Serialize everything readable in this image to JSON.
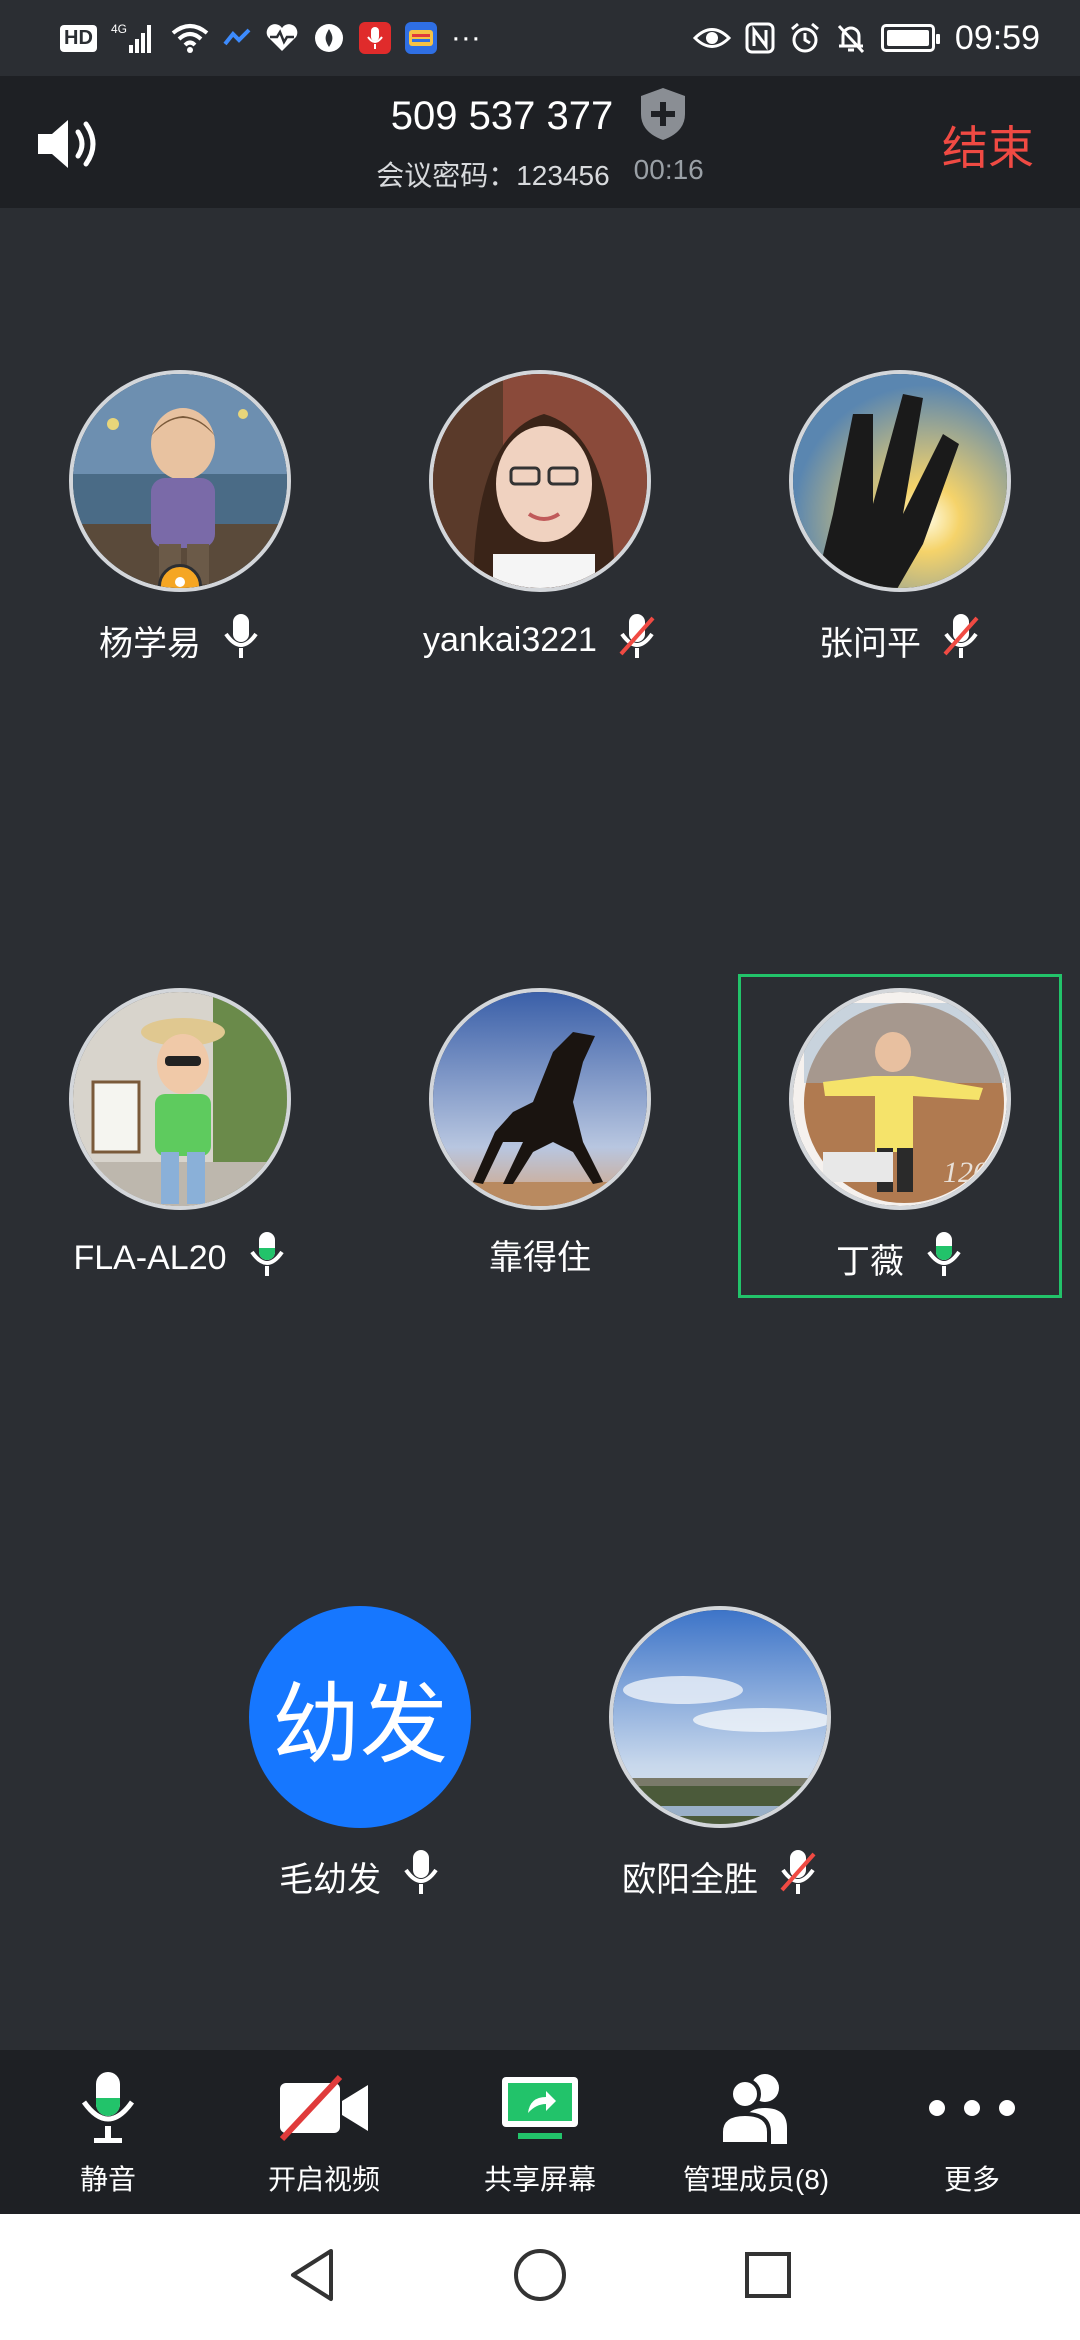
{
  "status_bar": {
    "left_icons": [
      "hd-icon",
      "signal-4g-icon",
      "wifi-icon",
      "app-icon",
      "health-icon",
      "app-icon",
      "mic-app-icon",
      "app-icon",
      "more-dots"
    ],
    "network": "4G",
    "hd": "HD",
    "more": "···",
    "time": "09:59"
  },
  "header": {
    "meeting_id": "509 537 377",
    "password_label": "会议密码：123456",
    "timer": "00:16",
    "end_label": "结束"
  },
  "participants": [
    {
      "name": "杨学易",
      "mic": "on",
      "host": true
    },
    {
      "name": "yankai3221",
      "mic": "muted"
    },
    {
      "name": "张问平",
      "mic": "muted"
    },
    {
      "name": "FLA-AL20",
      "mic": "speaking"
    },
    {
      "name": "靠得住",
      "mic": "none"
    },
    {
      "name": "丁薇",
      "mic": "speaking",
      "active": true
    },
    {
      "name": "毛幼发",
      "mic": "on",
      "avatar_text": "幼发"
    },
    {
      "name": "欧阳全胜",
      "mic": "muted"
    }
  ],
  "toolbar": {
    "mute_label": "静音",
    "video_label": "开启视频",
    "share_label": "共享屏幕",
    "members_label": "管理成员(8)",
    "more_label": "更多"
  },
  "colors": {
    "background": "#2b2e33",
    "header": "#1e2024",
    "end": "#f04a43",
    "mic_green": "#22c36a",
    "active_frame": "#22c36a",
    "text_avatar": "#1677ff",
    "host_badge": "#f5a623"
  }
}
